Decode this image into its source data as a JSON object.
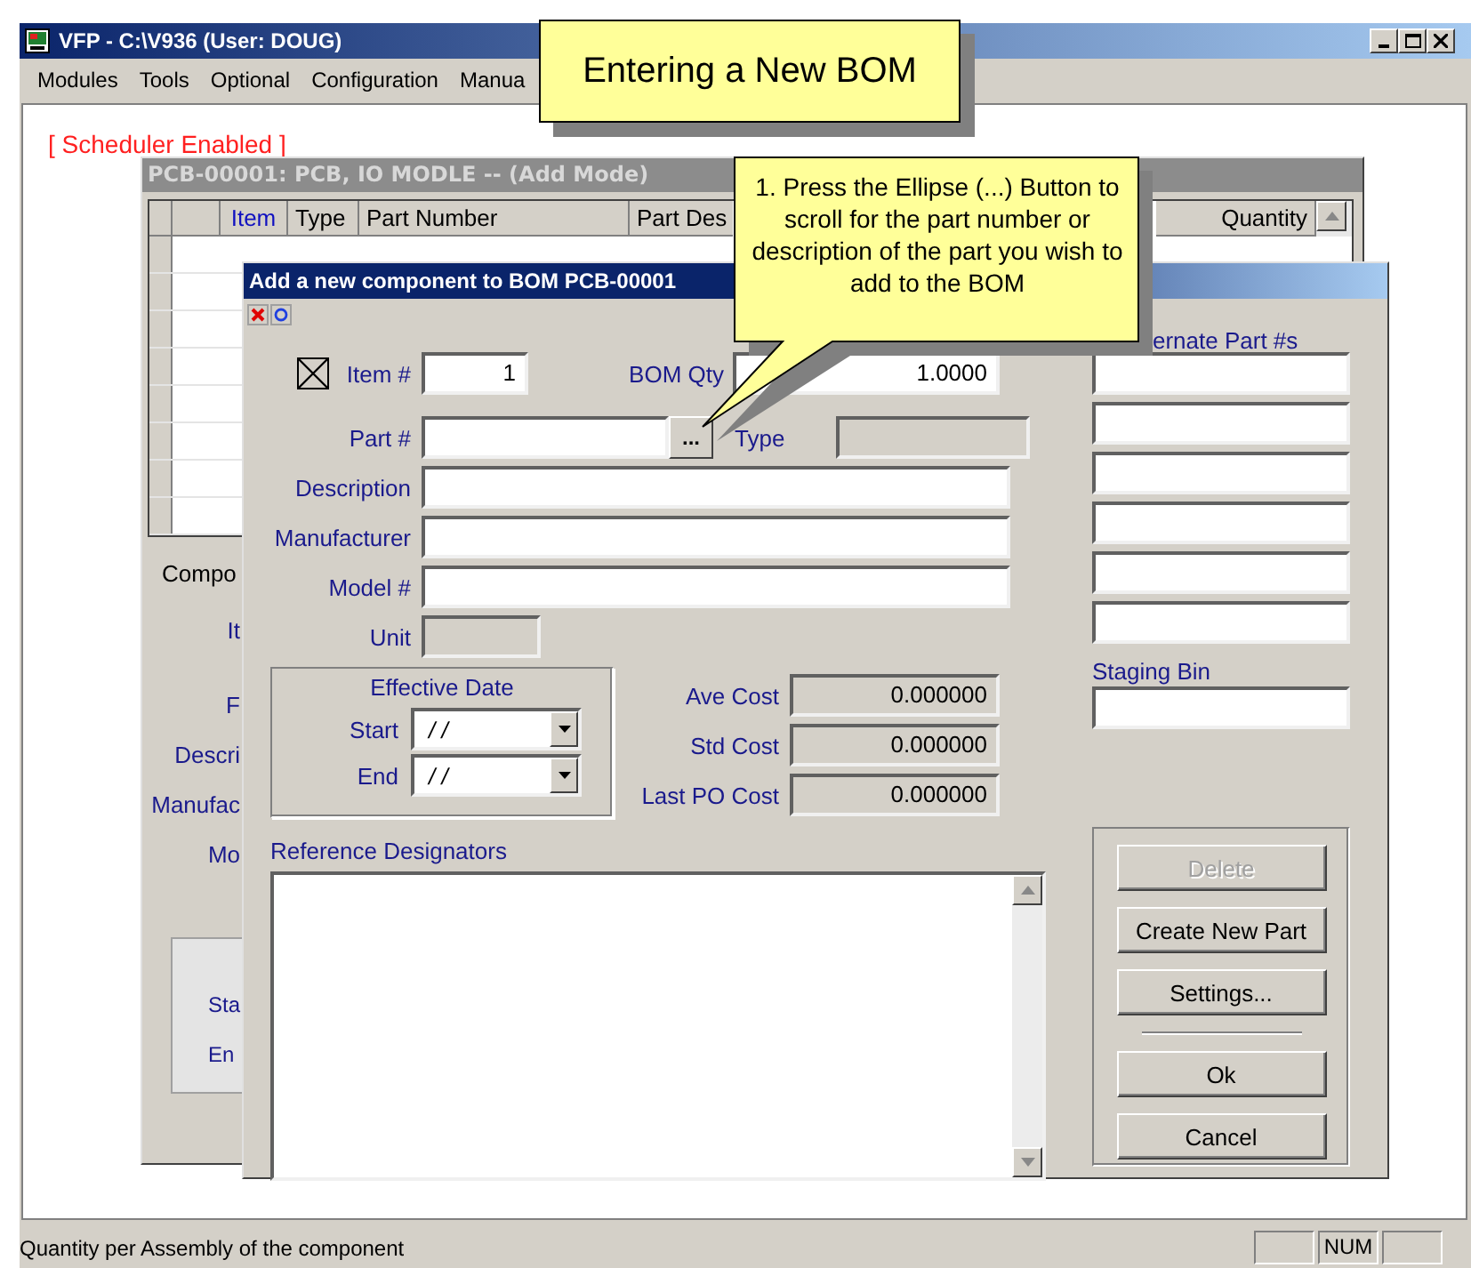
{
  "window": {
    "title": "VFP - C:\\V936  (User: DOUG)"
  },
  "menu": [
    "Modules",
    "Tools",
    "Optional",
    "Configuration",
    "Manua"
  ],
  "scheduler_notice": "[ Scheduler Enabled ]",
  "bom_window": {
    "title": "PCB-00001: PCB, IO MODLE -- (Add Mode)",
    "columns": [
      {
        "label": "Item",
        "highlighted": true
      },
      {
        "label": "Type",
        "highlighted": false
      },
      {
        "label": "Part Number",
        "highlighted": false
      },
      {
        "label": "Part Des",
        "highlighted": false
      },
      {
        "label": "Quantity",
        "highlighted": false
      }
    ],
    "section_label": "Compo",
    "field_labels": [
      "It",
      "F",
      "Descri",
      "Manufac",
      "Mo"
    ],
    "group_labels": [
      "Sta",
      "En"
    ]
  },
  "dialog": {
    "title": "Add a new component to BOM PCB-00001",
    "item": {
      "checked": true,
      "label": "Item #",
      "value": "1"
    },
    "bom_qty": {
      "label": "BOM Qty",
      "value": "1.0000"
    },
    "part": {
      "label": "Part #",
      "button": "..."
    },
    "type": {
      "label": "Type"
    },
    "text_fields": [
      {
        "label": "Description"
      },
      {
        "label": "Manufacturer"
      },
      {
        "label": "Model #"
      }
    ],
    "unit": {
      "label": "Unit"
    },
    "effective_date": {
      "title": "Effective Date",
      "rows": [
        {
          "label": "Start",
          "value": "/ /"
        },
        {
          "label": "End",
          "value": "/ /"
        }
      ]
    },
    "costs": [
      {
        "label": "Ave Cost",
        "value": "0.000000"
      },
      {
        "label": "Std Cost",
        "value": "0.000000"
      },
      {
        "label": "Last PO Cost",
        "value": "0.000000"
      }
    ],
    "reference_designators": {
      "label": "Reference Designators"
    },
    "alternates": {
      "label": "ernate Part #s"
    },
    "staging_bin": {
      "label": "Staging Bin"
    },
    "buttons": [
      {
        "label": "Delete",
        "disabled": true,
        "kind": "button"
      },
      {
        "label": "Create New Part",
        "disabled": false,
        "kind": "button"
      },
      {
        "label": "Settings...",
        "disabled": false,
        "kind": "button"
      },
      {
        "kind": "separator"
      },
      {
        "label": "Ok",
        "disabled": false,
        "kind": "button"
      },
      {
        "label": "Cancel",
        "disabled": false,
        "kind": "button"
      }
    ]
  },
  "callouts": [
    {
      "kind": "banner",
      "text": "Entering a New BOM"
    },
    {
      "kind": "pointer",
      "text": "1. Press the Ellipse (...) Button to scroll for the part number or description of the part you wish to add to the BOM"
    }
  ],
  "status_bar": {
    "text": "Quantity per Assembly of the component",
    "indicator": "NUM"
  }
}
